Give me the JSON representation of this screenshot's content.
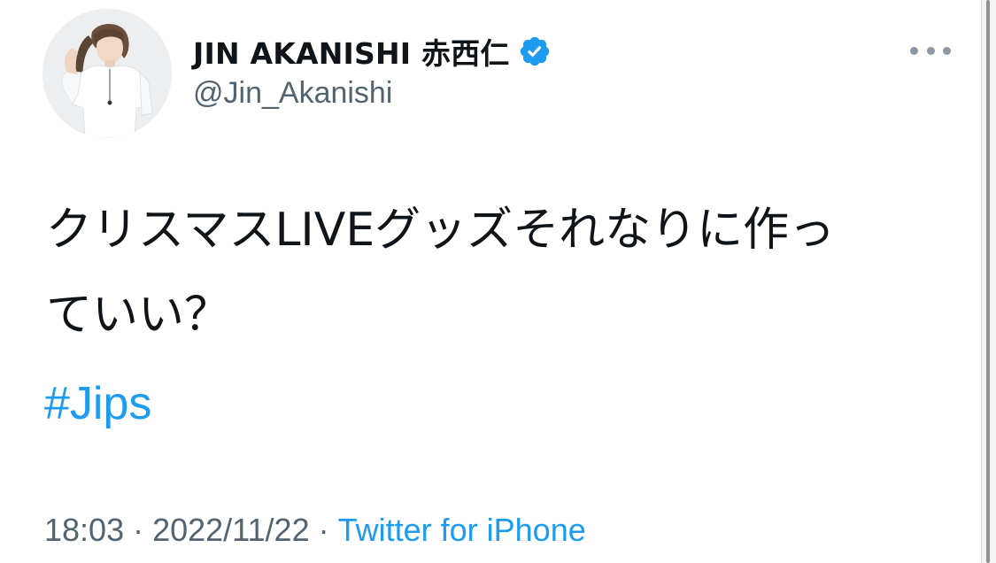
{
  "tweet": {
    "display_name": "JIN AKANISHI 赤西仁",
    "handle": "@Jin_Akanishi",
    "verified_icon": "verified-badge-icon",
    "more_icon": "more-options-icon",
    "text_lines": [
      "クリスマスLIVEグッズそれなりに作っ",
      "ていい？"
    ],
    "hashtag": "#Jips",
    "time": "18:03",
    "separator": "·",
    "date": "2022/11/22",
    "source": "Twitter for iPhone"
  },
  "colors": {
    "accent": "#1d9bf0",
    "text_primary": "#0f1419",
    "text_secondary": "#536471"
  }
}
